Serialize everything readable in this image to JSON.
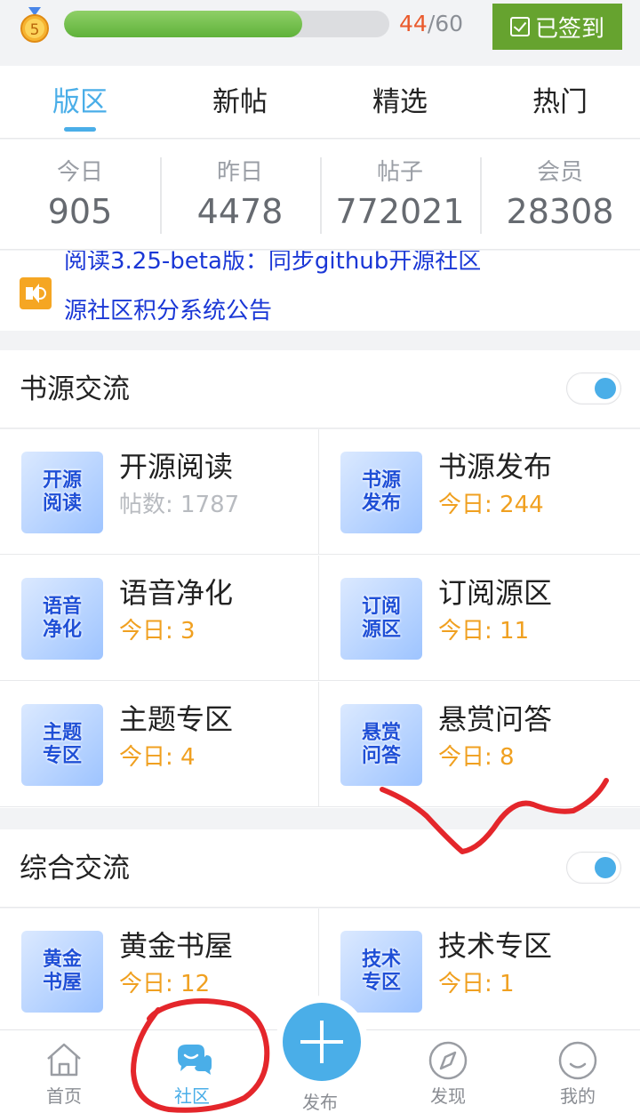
{
  "level": {
    "badge": "5",
    "progress_current": "44",
    "progress_total": "/60",
    "progress_fraction": 0.733,
    "checkin_label": "已签到"
  },
  "tabs": [
    {
      "label": "版区",
      "active": true
    },
    {
      "label": "新帖",
      "active": false
    },
    {
      "label": "精选",
      "active": false
    },
    {
      "label": "热门",
      "active": false
    }
  ],
  "stats": [
    {
      "label": "今日",
      "value": "905"
    },
    {
      "label": "昨日",
      "value": "4478"
    },
    {
      "label": "帖子",
      "value": "772021"
    },
    {
      "label": "会员",
      "value": "28308"
    }
  ],
  "notice": {
    "icon": "speaker-icon",
    "line1": "阅读3.25-beta版：同步github开源社区",
    "line2": "源社区积分系统公告"
  },
  "sections": [
    {
      "title": "书源交流",
      "enabled": true,
      "boards": [
        {
          "name": "开源阅读",
          "meta": "帖数: 1787",
          "thumb": [
            "开源",
            "阅读"
          ]
        },
        {
          "name": "书源发布",
          "meta": "今日: 244",
          "thumb": [
            "书源",
            "发布"
          ]
        },
        {
          "name": "语音净化",
          "meta": "今日: 3",
          "thumb": [
            "语音",
            "净化"
          ]
        },
        {
          "name": "订阅源区",
          "meta": "今日: 11",
          "thumb": [
            "订阅",
            "源区"
          ]
        },
        {
          "name": "主题专区",
          "meta": "今日: 4",
          "thumb": [
            "主题",
            "专区"
          ]
        },
        {
          "name": "悬赏问答",
          "meta": "今日: 8",
          "thumb": [
            "悬赏",
            "问答"
          ]
        }
      ]
    },
    {
      "title": "综合交流",
      "enabled": true,
      "boards": [
        {
          "name": "黄金书屋",
          "meta": "今日: 12",
          "thumb": [
            "黄金",
            "书屋"
          ]
        },
        {
          "name": "技术专区",
          "meta": "今日: 1",
          "thumb": [
            "技术",
            "专区"
          ]
        }
      ]
    }
  ],
  "bottom_nav": [
    {
      "label": "首页",
      "icon": "home-icon"
    },
    {
      "label": "社区",
      "icon": "chat-icon",
      "active": true
    },
    {
      "label": "发布",
      "icon": "plus-icon"
    },
    {
      "label": "发现",
      "icon": "compass-icon"
    },
    {
      "label": "我的",
      "icon": "smile-icon"
    }
  ],
  "colors": {
    "accent": "#4aaee8",
    "checkin": "#66a32f",
    "today": "#f0a020",
    "notice": "#1a37d6",
    "annotation": "#e4262b"
  }
}
